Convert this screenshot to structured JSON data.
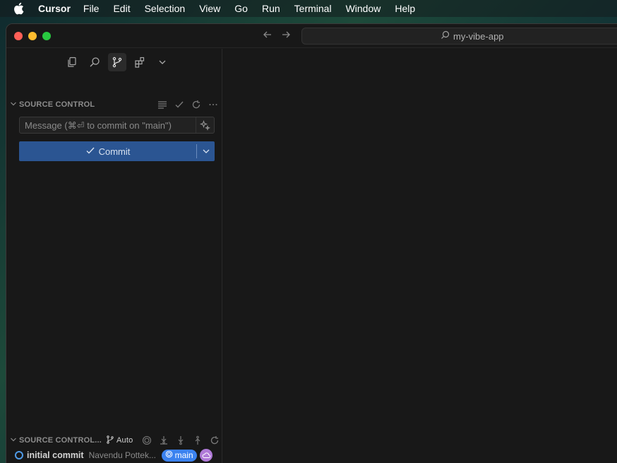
{
  "menubar": {
    "app_name": "Cursor",
    "items": [
      "File",
      "Edit",
      "Selection",
      "View",
      "Go",
      "Run",
      "Terminal",
      "Window",
      "Help"
    ]
  },
  "titlebar": {
    "search_label": "my-vibe-app"
  },
  "source_control": {
    "header": "SOURCE CONTROL",
    "commit_placeholder": "Message (⌘⏎ to commit on \"main\")",
    "commit_label": "Commit"
  },
  "graph": {
    "header": "SOURCE CONTROL...",
    "auto_label": "Auto",
    "commit": {
      "message": "initial commit",
      "author": "Navendu Pottek...",
      "branch": "main"
    }
  },
  "colors": {
    "accent": "#2b5592",
    "branch_badge": "#3b82f0",
    "remote_badge": "#b07ad8",
    "commit_dot": "#4f9be8"
  }
}
